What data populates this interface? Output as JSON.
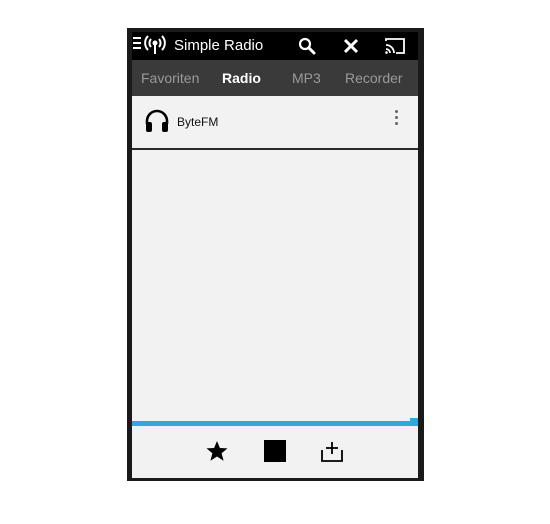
{
  "app": {
    "title": "Simple Radio"
  },
  "actionbar": {
    "icons": [
      "menu-icon",
      "radio-antenna-icon",
      "search-icon",
      "close-icon",
      "cast-icon"
    ]
  },
  "tabs": [
    {
      "label": "Favoriten",
      "active": false
    },
    {
      "label": "Radio",
      "active": true
    },
    {
      "label": "MP3",
      "active": false
    },
    {
      "label": "Recorder",
      "active": false
    }
  ],
  "stations": [
    {
      "name": "ByteFM",
      "icon": "headphones-icon"
    }
  ],
  "player": {
    "progress_fraction": 1.0,
    "controls": [
      "star-icon",
      "stop-icon",
      "add-to-queue-icon"
    ]
  },
  "colors": {
    "accent": "#2fa8e0",
    "actionbar": "#000000",
    "tabbar": "#3a3a3a",
    "background": "#f2f2f2"
  }
}
